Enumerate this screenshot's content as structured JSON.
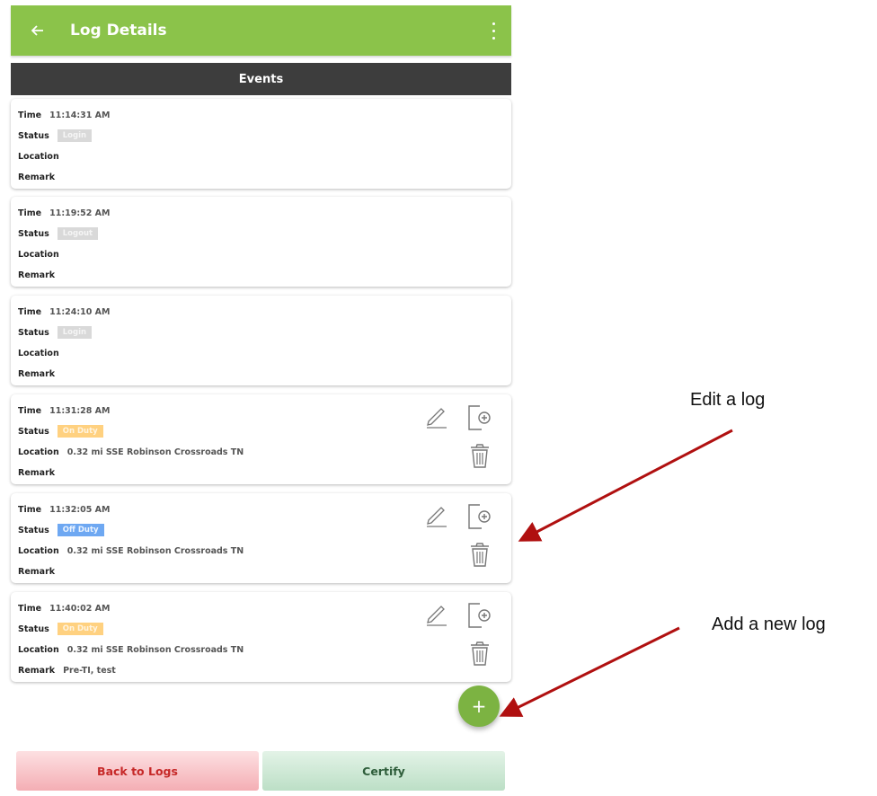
{
  "appbar": {
    "title": "Log Details",
    "color": "#8bc34a"
  },
  "section": {
    "title": "Events"
  },
  "labels": {
    "time": "Time",
    "status": "Status",
    "location": "Location",
    "remark": "Remark"
  },
  "events": [
    {
      "time": "11:14:31 AM",
      "status": "Login",
      "location": "",
      "remark": ""
    },
    {
      "time": "11:19:52 AM",
      "status": "Logout",
      "location": "",
      "remark": ""
    },
    {
      "time": "11:24:10 AM",
      "status": "Login",
      "location": "",
      "remark": ""
    },
    {
      "time": "11:31:28 AM",
      "status": "On Duty",
      "location": "0.32 mi SSE Robinson Crossroads TN",
      "remark": ""
    },
    {
      "time": "11:32:05 AM",
      "status": "Off Duty",
      "location": "0.32 mi SSE Robinson Crossroads TN",
      "remark": ""
    },
    {
      "time": "11:40:02 AM",
      "status": "On Duty",
      "location": "0.32 mi SSE Robinson Crossroads TN",
      "remark": "Pre-TI, test"
    }
  ],
  "fab": {
    "label": "+"
  },
  "buttons": {
    "back": "Back to Logs",
    "certify": "Certify"
  },
  "annotations": {
    "edit": "Edit a log",
    "add": "Add a new log",
    "arrow_color": "#b01010"
  },
  "icons": [
    "back-arrow-icon",
    "overflow-menu-icon",
    "pencil-icon",
    "add-document-icon",
    "trash-icon",
    "plus-icon"
  ]
}
